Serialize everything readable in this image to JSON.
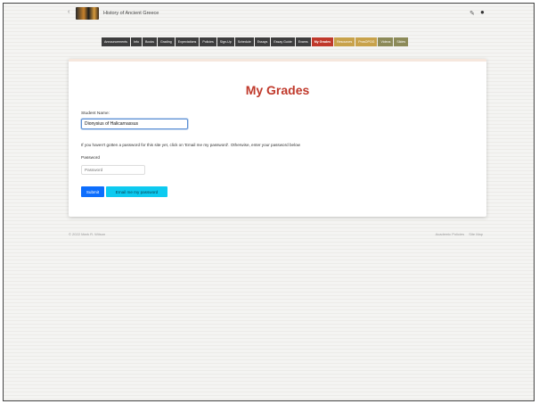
{
  "header": {
    "site_title": "History of Ancient Greece"
  },
  "nav": {
    "tabs": [
      {
        "label": "Announcements",
        "style": "dark"
      },
      {
        "label": "Info",
        "style": "dark"
      },
      {
        "label": "Books",
        "style": "dark"
      },
      {
        "label": "Grading",
        "style": "dark"
      },
      {
        "label": "Expectations",
        "style": "dark"
      },
      {
        "label": "Policies",
        "style": "dark"
      },
      {
        "label": "Sign-Up",
        "style": "dark"
      },
      {
        "label": "Schedule",
        "style": "dark"
      },
      {
        "label": "Essays",
        "style": "dark"
      },
      {
        "label": "Essay Guide",
        "style": "dark"
      },
      {
        "label": "Exams",
        "style": "dark"
      },
      {
        "label": "My Grades",
        "style": "active"
      },
      {
        "label": "Resources",
        "style": "gold"
      },
      {
        "label": "ProsOPOG",
        "style": "gold"
      },
      {
        "label": "Videos",
        "style": "olive"
      },
      {
        "label": "Slides",
        "style": "olive"
      }
    ]
  },
  "main": {
    "heading": "My Grades",
    "student_name_label": "Student Name:",
    "student_name_value": "Dionysius of Halicarnassus",
    "info_text": "If you haven't gotten a password for this site yet, click on 'Email me my password'. Otherwise, enter your password below",
    "password_label": "Password",
    "password_placeholder": "Password",
    "submit_label": "Submit",
    "email_label": "Email me my password"
  },
  "footer": {
    "copyright": "© 2022 Mark R. Wilson",
    "link_academic": "Academic Policies",
    "link_sitemap": "Site Map"
  },
  "colors": {
    "accent": "#c0392b",
    "primary_button": "#0d6efd",
    "info_button": "#0dcaf0"
  }
}
